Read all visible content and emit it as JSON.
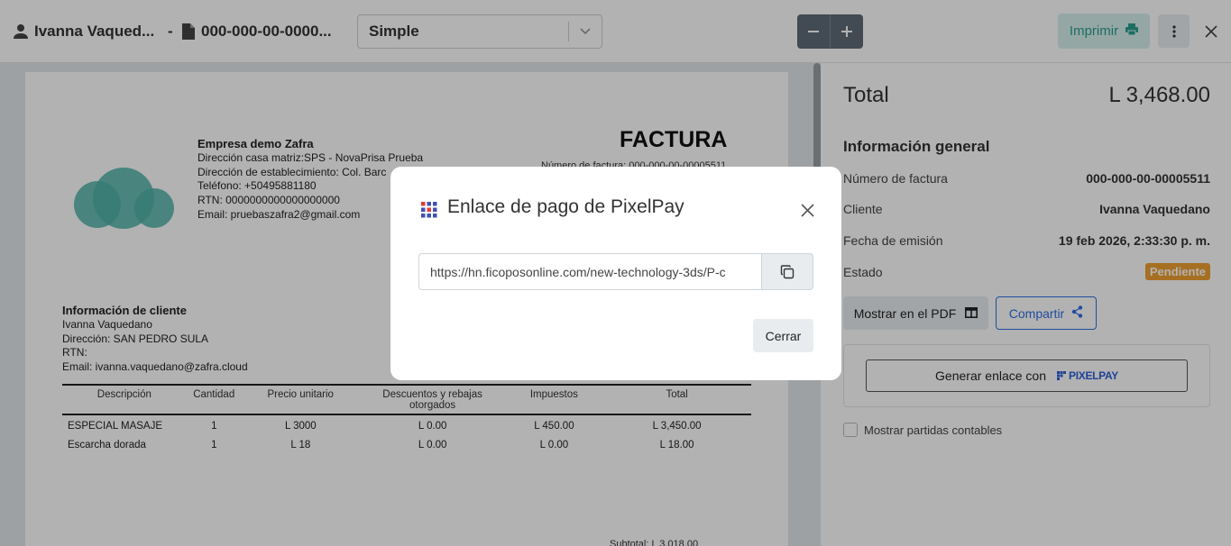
{
  "topbar": {
    "client_name": "Ivanna Vaqued...",
    "separator": "-",
    "invoice_number": "000-000-00-0000...",
    "format_select": "Simple",
    "print_label": "Imprimir"
  },
  "document": {
    "company": {
      "name": "Empresa demo Zafra",
      "lines": [
        "Dirección casa matriz:SPS - NovaPrisa Prueba",
        "Dirección de establecimiento: Col. Barc",
        "Teléfono: +50495881180",
        "RTN: 0000000000000000000",
        "Email: pruebaszafra2@gmail.com"
      ]
    },
    "title": "FACTURA",
    "invoice_number_line": "Número de factura: 000-000-00-00005511",
    "client": {
      "heading": "Información de cliente",
      "lines": [
        "Ivanna Vaquedano",
        "Dirección: SAN PEDRO SULA",
        "RTN:",
        "Email: ivanna.vaquedano@zafra.cloud"
      ]
    },
    "table": {
      "headers": [
        "Descripción",
        "Cantidad",
        "Precio unitario",
        "Descuentos y rebajas otorgados",
        "Impuestos",
        "Total"
      ],
      "rows": [
        [
          "ESPECIAL MASAJE",
          "1",
          "L 3000",
          "L 0.00",
          "L 450.00",
          "L 3,450.00"
        ],
        [
          "Escarcha dorada",
          "1",
          "L 18",
          "L 0.00",
          "L 0.00",
          "L 18.00"
        ]
      ]
    },
    "subtotal_peek": "Subtotal:                L 3,018.00"
  },
  "panel": {
    "total_label": "Total",
    "total_value": "L 3,468.00",
    "info_heading": "Información general",
    "rows": [
      {
        "label": "Número de factura",
        "value": "000-000-00-00005511"
      },
      {
        "label": "Cliente",
        "value": "Ivanna Vaquedano"
      },
      {
        "label": "Fecha de emisión",
        "value": "19 feb 2026, 2:33:30 p. m."
      },
      {
        "label": "Estado",
        "value": "Pendiente"
      }
    ],
    "show_pdf_label": "Mostrar en el PDF",
    "share_label": "Compartir",
    "generate_label": "Generar enlace con",
    "pixelpay_logo_text": "PIXELPAY",
    "accounting_label": "Mostrar partidas contables"
  },
  "modal": {
    "title": "Enlace de pago de PixelPay",
    "link_value": "https://hn.ficoposonline.com/new-technology-3ds/P-c",
    "close_label": "Cerrar"
  },
  "colors": {
    "accent_teal": "#2a9d8f",
    "badge_orange": "#f0a030",
    "share_blue": "#2f6fde"
  }
}
